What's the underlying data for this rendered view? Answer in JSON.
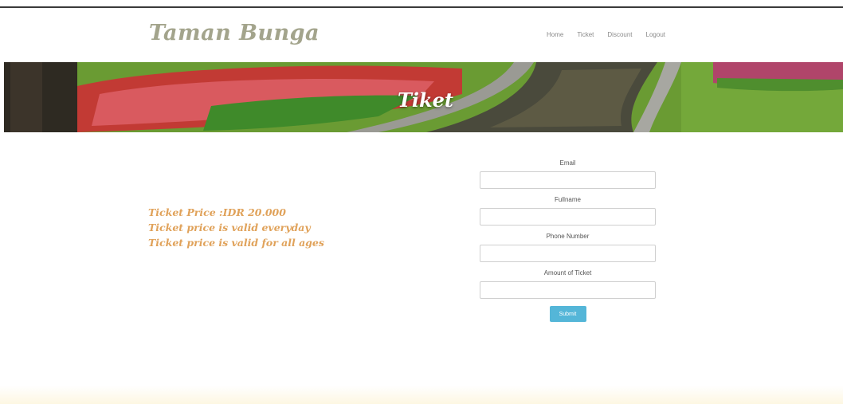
{
  "header": {
    "brand": "Taman Bunga",
    "nav": [
      "Home",
      "Ticket",
      "Discount",
      "Logout"
    ]
  },
  "hero": {
    "title": "Tiket"
  },
  "info": {
    "lines": [
      "Ticket Price :IDR 20.000",
      "Ticket price is valid everyday",
      "Ticket price is valid for all ages"
    ]
  },
  "form": {
    "fields": [
      {
        "label": "Email",
        "value": "",
        "placeholder": ""
      },
      {
        "label": "Fullname",
        "value": "",
        "placeholder": ""
      },
      {
        "label": "Phone Number",
        "value": "",
        "placeholder": ""
      },
      {
        "label": "Amount of Ticket",
        "value": "",
        "placeholder": ""
      }
    ],
    "submit_label": "Submit"
  },
  "colors": {
    "brand": "#a3a48c",
    "info_text": "#e0a25a",
    "submit": "#54b6d8"
  }
}
